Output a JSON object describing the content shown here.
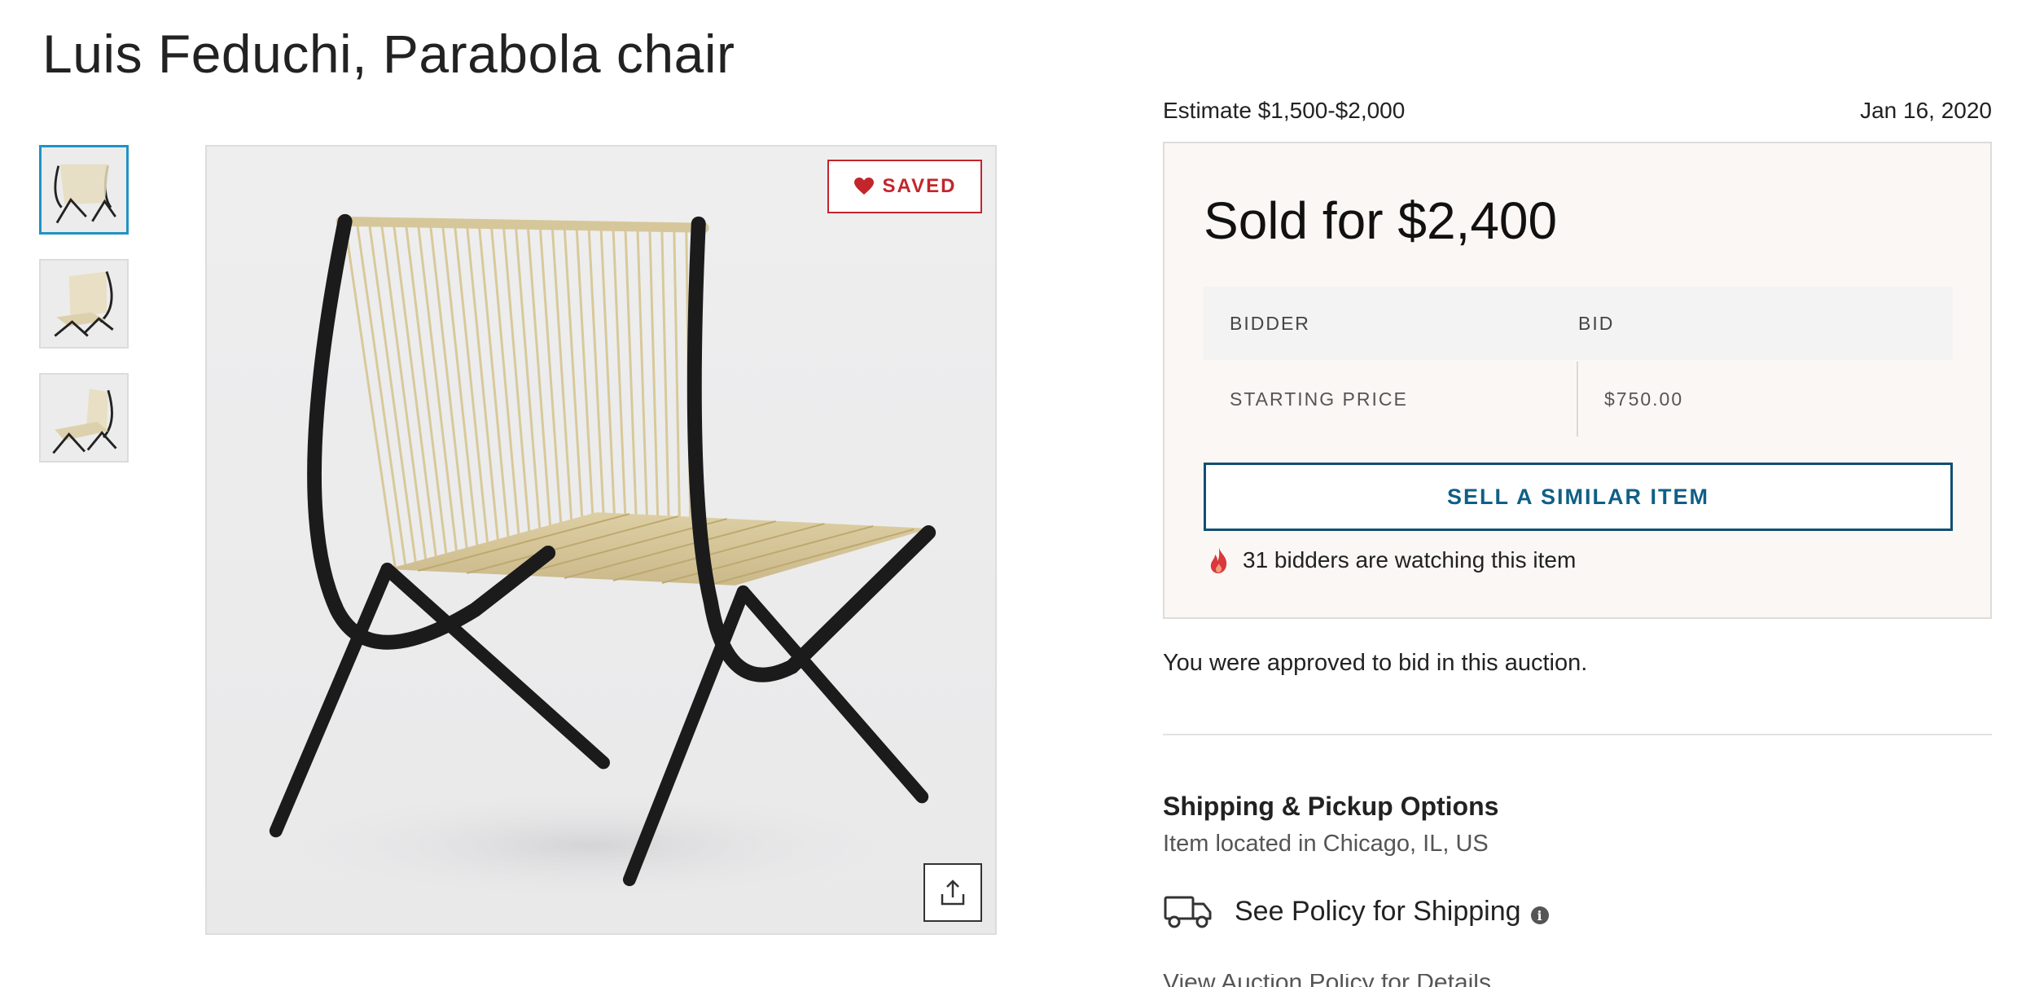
{
  "item": {
    "title": "Luis Feduchi, Parabola chair"
  },
  "gallery": {
    "thumbnails": [
      "thumbnail-1",
      "thumbnail-2",
      "thumbnail-3"
    ],
    "saved_label": "SAVED",
    "icons": {
      "saved": "heart-icon",
      "share": "share-icon"
    }
  },
  "auction": {
    "estimate": "Estimate $1,500-$2,000",
    "date": "Jan 16, 2020",
    "sold_for": "Sold for $2,400",
    "table": {
      "headers": [
        "BIDDER",
        "BID"
      ],
      "rows": [
        [
          "STARTING PRICE",
          "$750.00"
        ]
      ]
    },
    "sell_similar_label": "SELL A SIMILAR ITEM",
    "watching_text": "31 bidders are watching this item",
    "approved_text": "You were approved to bid in this auction."
  },
  "shipping": {
    "title": "Shipping & Pickup Options",
    "location": "Item located in Chicago, IL, US",
    "policy_label": "See Policy for Shipping",
    "partial_next_line": "View Auction Policy for Details"
  },
  "colors": {
    "accent_red": "#c3252c",
    "button_blue": "#0f5f86",
    "card_background": "#fbf7f4",
    "thumb_active_border": "#1f93c4"
  }
}
